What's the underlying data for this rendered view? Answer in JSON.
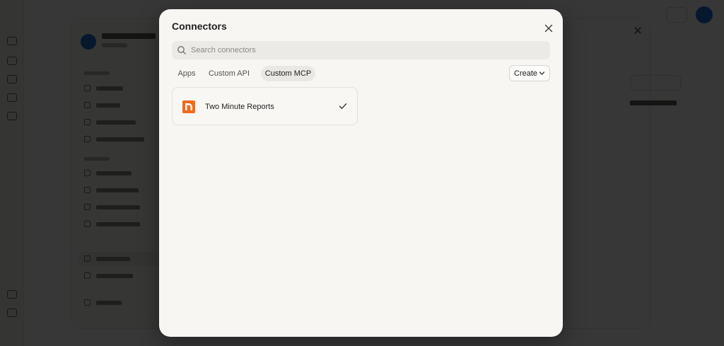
{
  "modal": {
    "title": "Connectors",
    "search": {
      "placeholder": "Search connectors",
      "value": ""
    },
    "tabs": [
      {
        "label": "Apps",
        "active": false
      },
      {
        "label": "Custom API",
        "active": false
      },
      {
        "label": "Custom MCP",
        "active": true
      }
    ],
    "create_label": "Create",
    "connectors": [
      {
        "name": "Two Minute Reports",
        "icon": "two-minute-reports-logo",
        "connected": true
      }
    ]
  },
  "colors": {
    "logo_orange": "#f06a1a",
    "avatar_blue": "#1f6fd1",
    "modal_bg": "#f7f6f3"
  }
}
